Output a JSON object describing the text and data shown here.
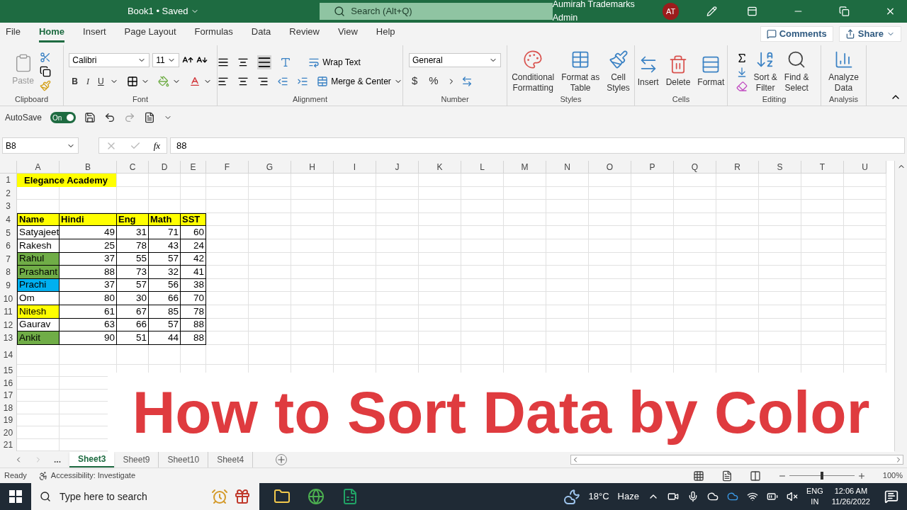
{
  "title_bar": {
    "document_title": "Book1 • Saved",
    "search_placeholder": "Search (Alt+Q)",
    "user_name": "Aumirah Trademarks Admin",
    "avatar_initials": "AT"
  },
  "menu_tabs": [
    {
      "label": "File",
      "selected": false
    },
    {
      "label": "Home",
      "selected": true
    },
    {
      "label": "Insert",
      "selected": false
    },
    {
      "label": "Page Layout",
      "selected": false
    },
    {
      "label": "Formulas",
      "selected": false
    },
    {
      "label": "Data",
      "selected": false
    },
    {
      "label": "Review",
      "selected": false
    },
    {
      "label": "View",
      "selected": false
    },
    {
      "label": "Help",
      "selected": false
    }
  ],
  "comments_button": "Comments",
  "share_button": "Share",
  "ribbon": {
    "clipboard": {
      "paste": "Paste",
      "label": "Clipboard"
    },
    "font": {
      "font_name": "Calibri",
      "font_size": "11",
      "bold": "B",
      "italic": "I",
      "underline": "U",
      "label": "Font"
    },
    "alignment": {
      "wrap_text": "Wrap Text",
      "merge_center": "Merge & Center",
      "label": "Alignment"
    },
    "number": {
      "format": "General",
      "currency": "$",
      "percent": "%",
      "label": "Number"
    },
    "styles": {
      "buttons": [
        {
          "lines": [
            "Conditional",
            "Formatting"
          ],
          "kind": "conditional"
        },
        {
          "lines": [
            "Format as",
            "Table"
          ],
          "kind": "table"
        },
        {
          "lines": [
            "Cell",
            "Styles"
          ],
          "kind": "styles"
        }
      ],
      "label": "Styles"
    },
    "cells": {
      "buttons": [
        {
          "lines": [
            "Insert"
          ],
          "kind": "insert"
        },
        {
          "lines": [
            "Delete"
          ],
          "kind": "delete"
        },
        {
          "lines": [
            "Format"
          ],
          "kind": "format"
        }
      ],
      "label": "Cells"
    },
    "editing": {
      "buttons": [
        {
          "lines": [
            "Sort &",
            "Filter"
          ],
          "kind": "sort"
        },
        {
          "lines": [
            "Find &",
            "Select"
          ],
          "kind": "find"
        }
      ],
      "label": "Editing"
    },
    "analysis": {
      "buttons": [
        {
          "lines": [
            "Analyze",
            "Data"
          ],
          "kind": "analyze"
        }
      ],
      "label": "Analysis"
    }
  },
  "quick_access": {
    "autosave_label": "AutoSave",
    "autosave_on": true,
    "toggle_text": "On"
  },
  "formula_bar": {
    "name_box": "B8",
    "fx": "fx",
    "formula": "88"
  },
  "sheet": {
    "columns": [
      "A",
      "B",
      "C",
      "D",
      "E",
      "F",
      "G",
      "H",
      "I",
      "J",
      "K",
      "L",
      "M",
      "N",
      "O",
      "P",
      "Q",
      "R",
      "S",
      "T",
      "U"
    ],
    "row_numbers": [
      "1",
      "2",
      "3",
      "4",
      "5",
      "6",
      "7",
      "8",
      "9",
      "10",
      "11",
      "12",
      "13",
      "14",
      "15",
      "16",
      "17",
      "18",
      "19",
      "20",
      "21"
    ],
    "title_cell": {
      "text": "Elegance Academy",
      "color": "#ffff00"
    },
    "header": {
      "cells": [
        "Name",
        "Hindi",
        "Eng",
        "Math",
        "SST"
      ],
      "color": "#ffff00"
    },
    "records": [
      {
        "name": "Satyajeet",
        "scores": [
          "49",
          "31",
          "71",
          "60"
        ]
      },
      {
        "name": "Rakesh",
        "scores": [
          "25",
          "78",
          "43",
          "24"
        ]
      },
      {
        "name": "Rahul",
        "color": "#70ad47",
        "scores": [
          "37",
          "55",
          "57",
          "42"
        ]
      },
      {
        "name": "Prashant",
        "color": "#70ad47",
        "scores": [
          "88",
          "73",
          "32",
          "41"
        ]
      },
      {
        "name": "Prachi",
        "color": "#00b0f0",
        "scores": [
          "37",
          "57",
          "56",
          "38"
        ]
      },
      {
        "name": "Om",
        "scores": [
          "80",
          "30",
          "66",
          "70"
        ]
      },
      {
        "name": "Nitesh",
        "color": "#ffff00",
        "scores": [
          "61",
          "67",
          "85",
          "78"
        ]
      },
      {
        "name": "Gaurav",
        "scores": [
          "63",
          "66",
          "57",
          "88"
        ]
      },
      {
        "name": "Ankit",
        "color": "#70ad47",
        "scores": [
          "90",
          "51",
          "44",
          "88"
        ]
      }
    ]
  },
  "overlay_caption": "How to Sort Data by Color",
  "sheet_tabs": {
    "more": "...",
    "tabs": [
      {
        "label": "Sheet3",
        "selected": true
      },
      {
        "label": "Sheet9",
        "selected": false
      },
      {
        "label": "Sheet10",
        "selected": false
      },
      {
        "label": "Sheet4",
        "selected": false
      }
    ]
  },
  "status_bar": {
    "ready": "Ready",
    "accessibility": "Accessibility: Investigate",
    "zoom": {
      "level": 0.5,
      "reading": "100%"
    }
  },
  "taskbar": {
    "search_placeholder": "Type here to search",
    "temperature": "18°C",
    "weather": "Haze",
    "language": "ENG",
    "region": "IN",
    "time": "12:06 AM",
    "date": "11/26/2022"
  }
}
